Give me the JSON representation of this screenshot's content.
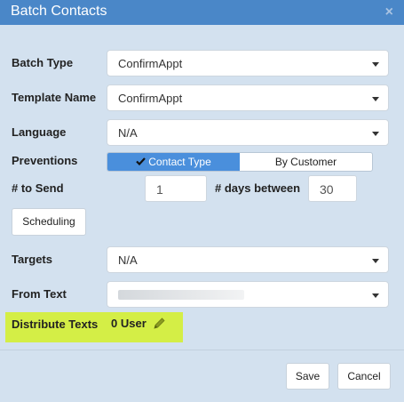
{
  "dialog": {
    "title": "Batch Contacts",
    "close_glyph": "×"
  },
  "fields": {
    "batch_type": {
      "label": "Batch Type",
      "value": "ConfirmAppt"
    },
    "template_name": {
      "label": "Template Name",
      "value": "ConfirmAppt"
    },
    "language": {
      "label": "Language",
      "value": "N/A"
    },
    "preventions": {
      "label": "Preventions",
      "options": [
        "Contact Type",
        "By Customer"
      ],
      "selected": "Contact Type"
    },
    "to_send": {
      "label": "# to Send",
      "value": "1"
    },
    "days_between": {
      "label": "# days between",
      "value": "30"
    },
    "targets": {
      "label": "Targets",
      "value": "N/A"
    },
    "from_text": {
      "label": "From Text",
      "value": ""
    },
    "distribute": {
      "label": "Distribute Texts",
      "value": "0 User"
    }
  },
  "buttons": {
    "scheduling": "Scheduling",
    "save": "Save",
    "cancel": "Cancel"
  },
  "icons": {
    "check": "check-icon",
    "pencil": "pencil-icon",
    "caret": "chevron-down-icon",
    "close": "close-icon"
  },
  "colors": {
    "titlebar": "#4a87c8",
    "background": "#d3e1ef",
    "segment_active": "#4a8fdc",
    "highlight": "#d4ee46"
  }
}
